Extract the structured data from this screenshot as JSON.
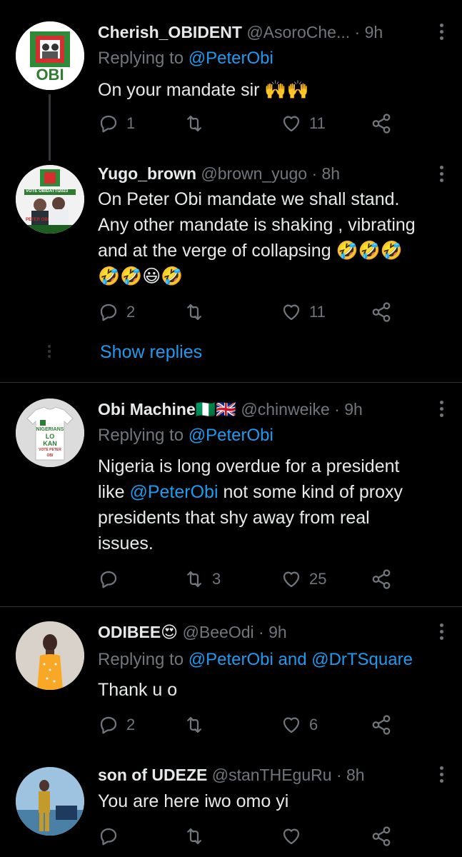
{
  "tweets": [
    {
      "name": "Cherish_OBIDENT",
      "handle": "@AsoroChe...",
      "time": "· 9h",
      "replying_prefix": "Replying to ",
      "replying_to": "@PeterObi",
      "text": "On your mandate sir 🙌🙌",
      "replies": "1",
      "retweets": "",
      "likes": "11"
    },
    {
      "name": "Yugo_brown",
      "handle": "@brown_yugo",
      "time": "· 8h",
      "text_lines": [
        "On Peter Obi mandate we shall stand.",
        "Any other mandate is shaking , vibrating",
        "and at the verge of collapsing 🤣🤣🤣",
        "🤣🤣😃🤣"
      ],
      "replies": "2",
      "retweets": "",
      "likes": "11"
    },
    {
      "name": "Obi Machine🇳🇬🇬🇧",
      "handle": "@chinweike",
      "time": "· 9h",
      "replying_prefix": "Replying to ",
      "replying_to": "@PeterObi",
      "text_part1": "Nigeria is long overdue for a president",
      "text_part2_prefix": "like ",
      "text_mention": "@PeterObi",
      "text_part2_suffix": " not some kind of proxy",
      "text_part3": "presidents that shy away from real",
      "text_part4": "issues.",
      "replies": "",
      "retweets": "3",
      "likes": "25"
    },
    {
      "name": "ODIBEE😍",
      "handle": "@BeeOdi",
      "time": "· 9h",
      "replying_prefix": "Replying to ",
      "replying_to": "@PeterObi and @DrTSquare",
      "text": "Thank u o",
      "replies": "2",
      "retweets": "",
      "likes": "6"
    },
    {
      "name": "son of UDEZE",
      "handle": "@stanTHEguRu",
      "time": "· 8h",
      "text": "You are here iwo omo yi",
      "replies": "",
      "retweets": "",
      "likes": ""
    }
  ],
  "show_replies": "Show replies",
  "avatar_texts": {
    "obi_logo": "OBI",
    "vote_banner": "VOTE OBIDATTI2023",
    "peter_obi": "PETER OBI",
    "shirt_line1": "NIGERIANS",
    "shirt_line2": "LO",
    "shirt_line3": "KAN",
    "shirt_line4": "VOTE PETER OBI"
  },
  "colors": {
    "background": "#000000",
    "text": "#e7e9ea",
    "muted": "#71767b",
    "link": "#1d9bf0",
    "divider": "#2f3336"
  }
}
